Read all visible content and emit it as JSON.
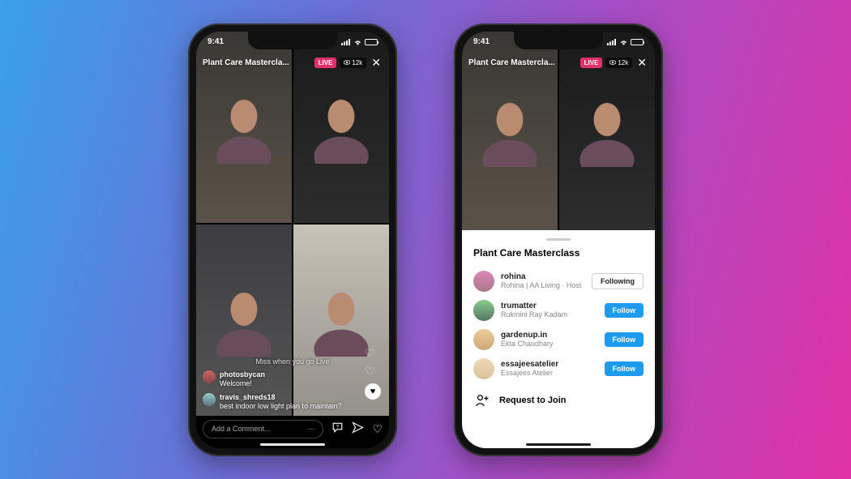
{
  "status": {
    "time": "9:41"
  },
  "live": {
    "title": "Plant Care Mastercla...",
    "badge": "LIVE",
    "viewer_count": "12k"
  },
  "comments": {
    "system_msg": "Miss when you go Live",
    "items": [
      {
        "user": "photosbycan",
        "text": "Welcome!"
      },
      {
        "user": "travis_shreds18",
        "text": "best indoor low light plan to maintain?"
      }
    ],
    "placeholder": "Add a Comment..."
  },
  "sheet": {
    "title": "Plant Care Masterclass",
    "participants": [
      {
        "handle": "rohina",
        "sub": "Rohina | AA Living · Host",
        "action": "Following",
        "state": "following"
      },
      {
        "handle": "trumatter",
        "sub": "Rukmini Ray Kadam",
        "action": "Follow",
        "state": "follow"
      },
      {
        "handle": "gardenup.in",
        "sub": "Ekta Chaudhary",
        "action": "Follow",
        "state": "follow"
      },
      {
        "handle": "essajeesatelier",
        "sub": "Essajees Atelier",
        "action": "Follow",
        "state": "follow"
      }
    ],
    "request_label": "Request to Join"
  }
}
